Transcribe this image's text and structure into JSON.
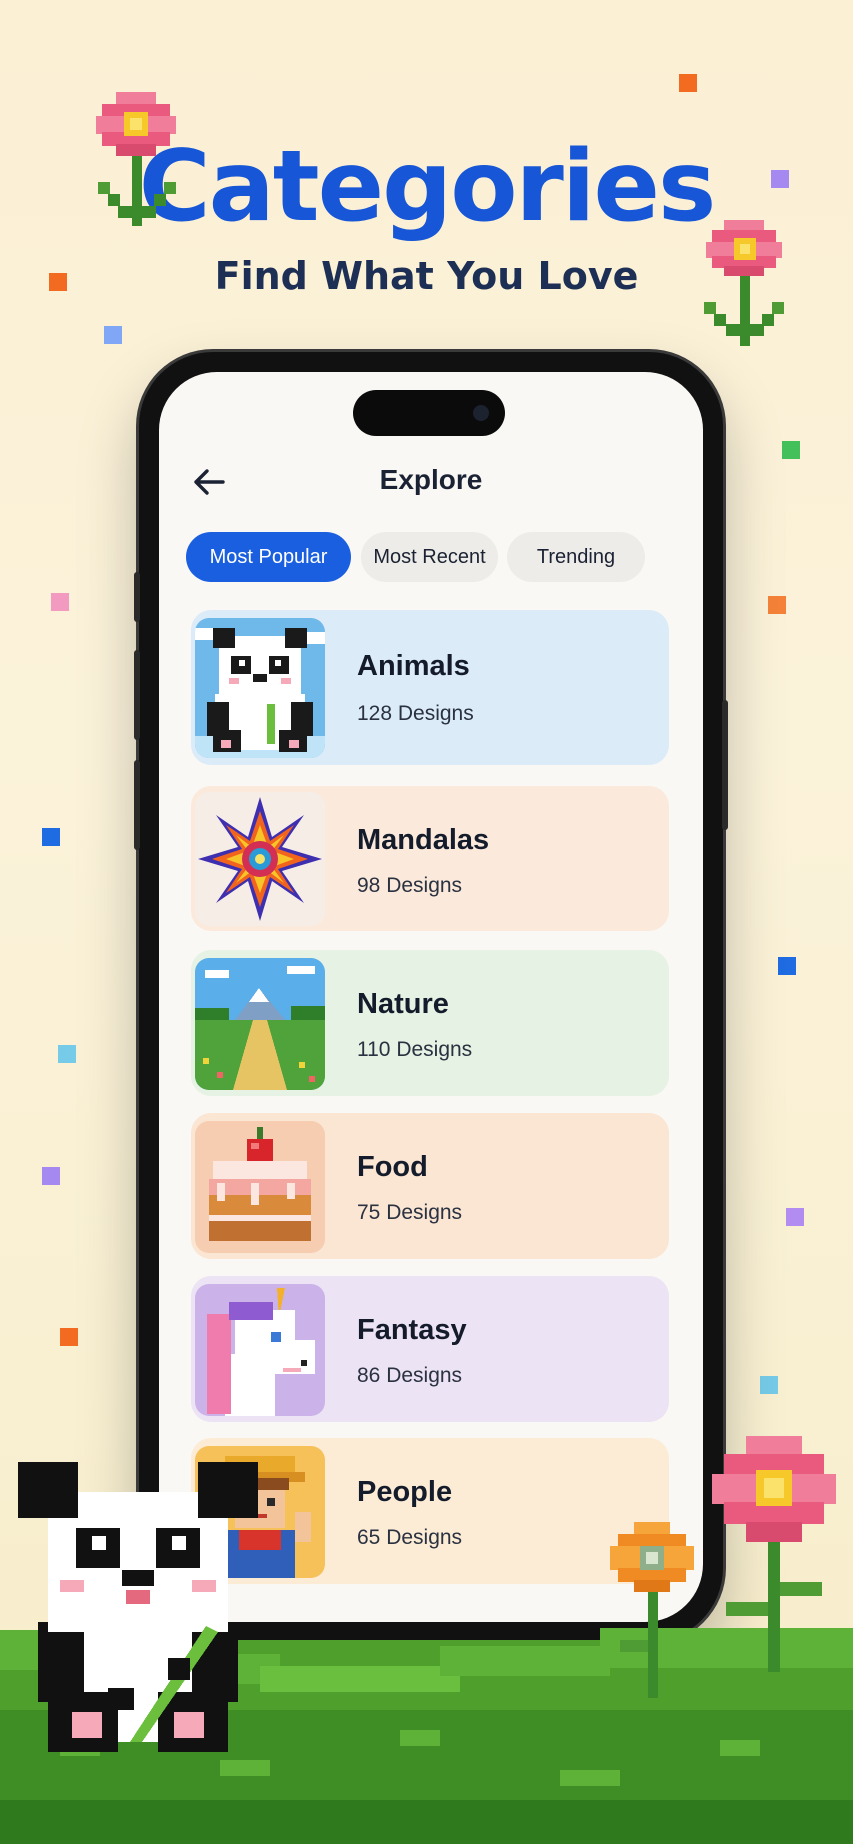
{
  "hero": {
    "title": "Categories",
    "subtitle": "Find What You Love"
  },
  "screen": {
    "nav": {
      "back_icon": "arrow-left-icon",
      "title": "Explore"
    },
    "filters": [
      {
        "label": "Most Popular",
        "active": true
      },
      {
        "label": "Most Recent",
        "active": false
      },
      {
        "label": "Trending",
        "active": false
      }
    ],
    "categories": [
      {
        "name": "Animals",
        "count": "128 Designs",
        "color": "#dcebf8",
        "icon": "panda-icon"
      },
      {
        "name": "Mandalas",
        "count": "98 Designs",
        "color": "#fbeadb",
        "icon": "mandala-icon"
      },
      {
        "name": "Nature",
        "count": "110 Designs",
        "color": "#e5f2e4",
        "icon": "landscape-icon"
      },
      {
        "name": "Food",
        "count": "75 Designs",
        "color": "#fbe5d3",
        "icon": "cake-icon"
      },
      {
        "name": "Fantasy",
        "count": "86 Designs",
        "color": "#ece3f5",
        "icon": "unicorn-icon"
      },
      {
        "name": "People",
        "count": "65 Designs",
        "color": "#fcecd6",
        "icon": "farmer-icon"
      }
    ]
  },
  "colors": {
    "accent": "#1a5fe0",
    "title": "#1756d6",
    "subtitle": "#1d2f55"
  }
}
